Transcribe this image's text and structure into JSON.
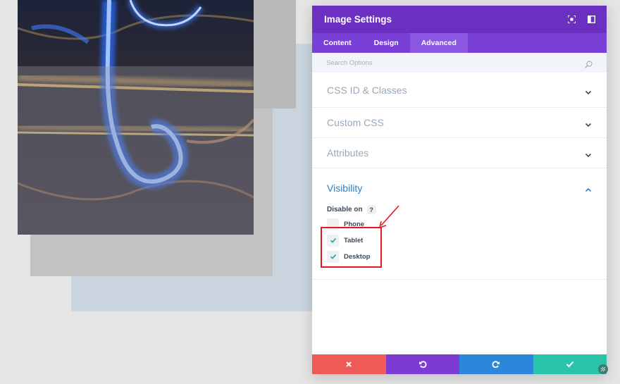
{
  "modal": {
    "title": "Image Settings",
    "tabs": [
      {
        "label": "Content",
        "active": false
      },
      {
        "label": "Design",
        "active": false
      },
      {
        "label": "Advanced",
        "active": true
      }
    ],
    "search_placeholder": "Search Options",
    "sections": [
      {
        "label": "CSS ID & Classes"
      },
      {
        "label": "Custom CSS"
      },
      {
        "label": "Attributes"
      }
    ],
    "visibility": {
      "title": "Visibility",
      "disable_label": "Disable on",
      "help": "?",
      "options": [
        {
          "label": "Phone",
          "checked": false
        },
        {
          "label": "Tablet",
          "checked": true
        },
        {
          "label": "Desktop",
          "checked": true
        }
      ]
    }
  },
  "colors": {
    "header": "#6b2fc1",
    "tabs": "#7a3fd6",
    "cancel": "#ef5a57",
    "undo": "#7e3bd4",
    "redo": "#2b87da",
    "save": "#29c4a9",
    "annotation": "#e5161f"
  },
  "icons": {
    "header_left": "expand-icon",
    "header_right": "sidebar-toggle-icon",
    "search": "search-icon",
    "cancel": "close-icon",
    "undo": "undo-icon",
    "redo": "redo-icon",
    "save": "check-icon"
  }
}
